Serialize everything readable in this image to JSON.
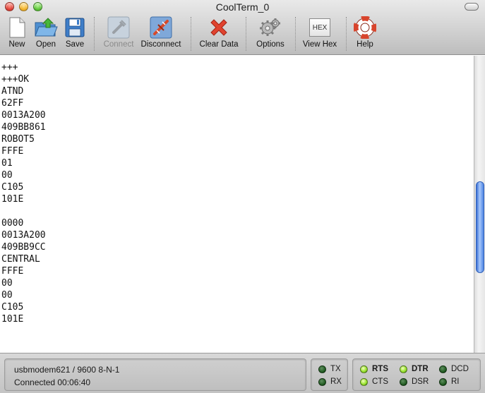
{
  "window": {
    "title": "CoolTerm_0"
  },
  "toolbar": {
    "new": "New",
    "open": "Open",
    "save": "Save",
    "connect": "Connect",
    "disconnect": "Disconnect",
    "clear_data": "Clear Data",
    "options": "Options",
    "view_hex": "View Hex",
    "view_hex_icon_text": "HEX",
    "help": "Help"
  },
  "terminal": {
    "lines": [
      "+++",
      "+++OK",
      "ATND",
      "62FF",
      "0013A200",
      "409BB861",
      "ROBOT5",
      "FFFE",
      "01",
      "00",
      "C105",
      "101E",
      "",
      "0000",
      "0013A200",
      "409BB9CC",
      "CENTRAL",
      "FFFE",
      "00",
      "00",
      "C105",
      "101E"
    ],
    "scroll_position": 0.62
  },
  "status": {
    "port_settings": "usbmodem621 / 9600 8-N-1",
    "connection": "Connected 00:06:40",
    "tx": "TX",
    "rx": "RX",
    "rts": "RTS",
    "cts": "CTS",
    "dtr": "DTR",
    "dsr": "DSR",
    "dcd": "DCD",
    "ri": "RI"
  },
  "indicators": {
    "tx": false,
    "rx": false,
    "rts": true,
    "cts": true,
    "dtr": true,
    "dsr": false,
    "dcd": false,
    "ri": false
  },
  "icons": {
    "new": "document-icon",
    "open": "folder-open-icon",
    "save": "floppy-disk-icon",
    "connect": "plug-connect-icon",
    "disconnect": "plug-disconnect-icon",
    "clear_data": "red-x-icon",
    "options": "gears-icon",
    "view_hex": "hex-icon",
    "help": "lifebuoy-icon"
  },
  "colors": {
    "led_on": "#9ae430",
    "led_off": "#1f5a1f",
    "scroll_thumb": "#4c83e3",
    "clear_data_x": "#d83a2a"
  }
}
